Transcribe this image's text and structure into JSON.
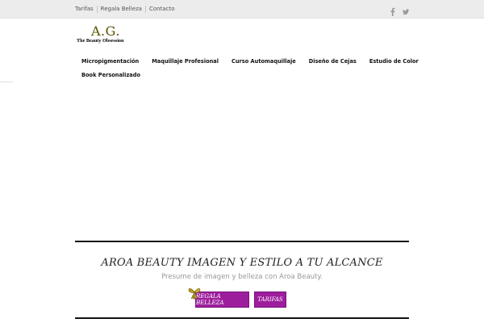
{
  "topbar": {
    "links": [
      "Tarifas",
      "Regala Belleza",
      "Contacto"
    ],
    "social": [
      {
        "icon": "facebook-icon",
        "color": "#9a9a9a"
      },
      {
        "icon": "twitter-icon",
        "color": "#9a9a9a"
      }
    ]
  },
  "logo": {
    "initials": "A.G.",
    "tagline": "The Beauty Obsession"
  },
  "nav": {
    "items": [
      "Micropigmentación",
      "Maquillaje Profesional",
      "Curso Automaquillaje",
      "Diseño de Cejas",
      "Estudio de Color",
      "Book Personalizado"
    ]
  },
  "hero": {
    "heading": "AROA BEAUTY IMAGEN Y ESTILO A TU ALCANCE",
    "subheading": "Presume de imagen y belleza con Aroa Beauty.",
    "buttons": [
      "REGALA BELLEZA",
      "TARIFAS"
    ],
    "button_color": "#9d1e9d",
    "bow_icon": "gift-bow-icon"
  }
}
